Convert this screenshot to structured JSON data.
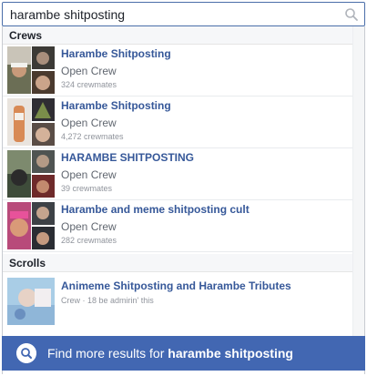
{
  "search": {
    "value": "harambe shitposting"
  },
  "sections": {
    "crews_label": "Crews",
    "scrolls_label": "Scrolls"
  },
  "crews": [
    {
      "name": "Harambe Shitposting",
      "type": "Open Crew",
      "members": "324 crewmates"
    },
    {
      "name": "Harambe Shitposting",
      "type": "Open Crew",
      "members": "4,272 crewmates"
    },
    {
      "name": "HARAMBE SHITPOSTING",
      "type": "Open Crew",
      "members": "39 crewmates"
    },
    {
      "name": "Harambe and meme shitposting cult",
      "type": "Open Crew",
      "members": "282 crewmates"
    }
  ],
  "scrolls": [
    {
      "title": "Animeme Shitposting and Harambe Tributes",
      "meta": "Crew · 18 be admirin' this"
    }
  ],
  "footer": {
    "prefix": "Find more results for",
    "query": "harambe shitposting"
  },
  "colors": {
    "accent": "#4267b2",
    "link": "#365899",
    "search_border": "#4a6ea9"
  },
  "icons": {
    "search": "search-icon",
    "footer": "magnifier-icon"
  }
}
